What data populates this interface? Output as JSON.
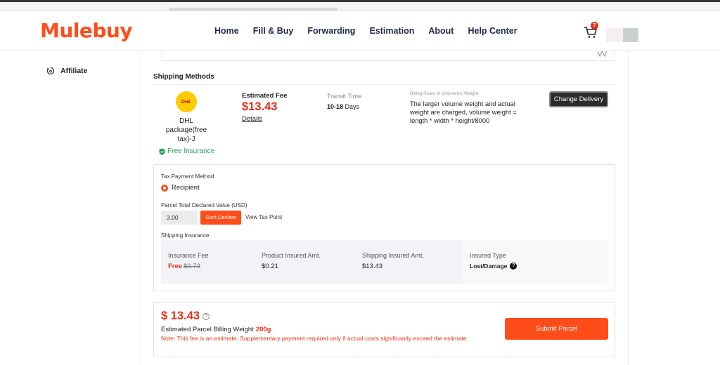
{
  "header": {
    "logo": "Mulebuy",
    "nav": [
      "Home",
      "Fill & Buy",
      "Forwarding",
      "Estimation",
      "About",
      "Help Center"
    ],
    "cart_count": "7"
  },
  "sidebar": {
    "items": [
      {
        "label": "Affiliate",
        "icon": "affiliate-icon"
      }
    ]
  },
  "shipping": {
    "section_title": "Shipping Methods",
    "carrier_logo_text": "DHL",
    "carrier_name": "DHL package(free tax)-J",
    "free_insurance": "Free Insurance",
    "estimated_fee_label": "Estimated Fee",
    "estimated_fee_value": "$13.43",
    "details_link": "Details",
    "transit_label": "Transit Time",
    "transit_days": "10-18",
    "transit_unit": "Days",
    "billing_rules_label": "Billing Rules of Volumetric Weight:",
    "billing_rules_text": "The larger volume weight and actual weight are charged, volume weight = length * width * height/8000",
    "change_delivery_button": "Change Delivery"
  },
  "tax": {
    "payment_method_label": "Tax Payment Method",
    "payment_option": "Recipient",
    "declared_label": "Parcel Total Declared Value (USD)",
    "declared_value": "3.00",
    "start_declare_button": "Start Declare",
    "view_tax_point": "View Tax Point",
    "shipping_insurance_label": "Shipping Insurance"
  },
  "insurance": {
    "fee_label": "Insurance Fee",
    "fee_free": "Free",
    "fee_original": "$3.73",
    "product_label": "Product Insured Amt.",
    "product_value": "$0.21",
    "shipping_label": "Shipping Insured Amt.",
    "shipping_value": "$13.43",
    "type_label": "Insured Type",
    "type_value": "Lost/Damage"
  },
  "summary": {
    "price": "$ 13.43",
    "weight_label": "Estimated Parcel Billing Weight",
    "weight_value": "200g",
    "note": "Note: This fee is an estimate. Supplementary payment required only if actual costs significantly exceed the estimate.",
    "submit_button": "Submit Parcel"
  },
  "colors": {
    "brand": "#ff4d1a",
    "price_red": "#e5321a",
    "nav_text": "#1d2a4d",
    "success_green": "#1f9d55"
  }
}
